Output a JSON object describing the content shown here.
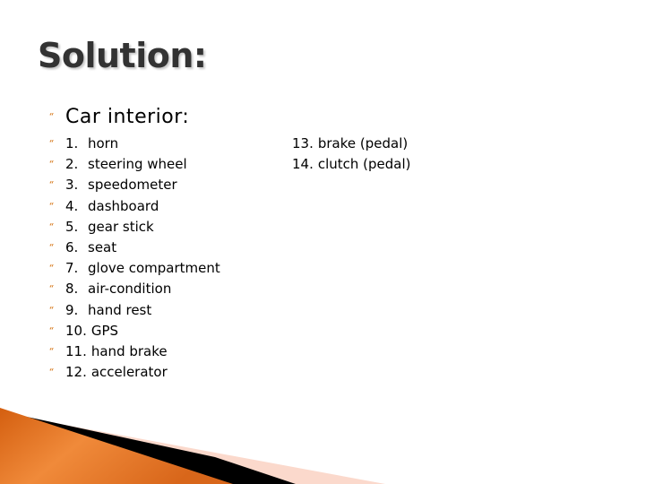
{
  "slide": {
    "title": "Solution:",
    "heading": "Car interior:",
    "bullet_glyph": "“",
    "bullet_color": "#d9822b",
    "accent_orange": "#e0661a",
    "items_left": [
      {
        "num": "1.",
        "label": "horn"
      },
      {
        "num": "2.",
        "label": "steering wheel"
      },
      {
        "num": "3.",
        "label": "speedometer"
      },
      {
        "num": "4.",
        "label": "dashboard"
      },
      {
        "num": "5.",
        "label": "gear stick"
      },
      {
        "num": "6.",
        "label": "seat"
      },
      {
        "num": "7.",
        "label": "glove compartment"
      },
      {
        "num": "8.",
        "label": "air-condition"
      },
      {
        "num": "9.",
        "label": "hand rest"
      },
      {
        "num": "10.",
        "label": "GPS"
      },
      {
        "num": "11.",
        "label": "hand brake"
      },
      {
        "num": "12.",
        "label": "accelerator"
      }
    ],
    "items_right": [
      {
        "num": "13.",
        "label": "brake (pedal)"
      },
      {
        "num": "14.",
        "label": "clutch (pedal)"
      }
    ]
  }
}
